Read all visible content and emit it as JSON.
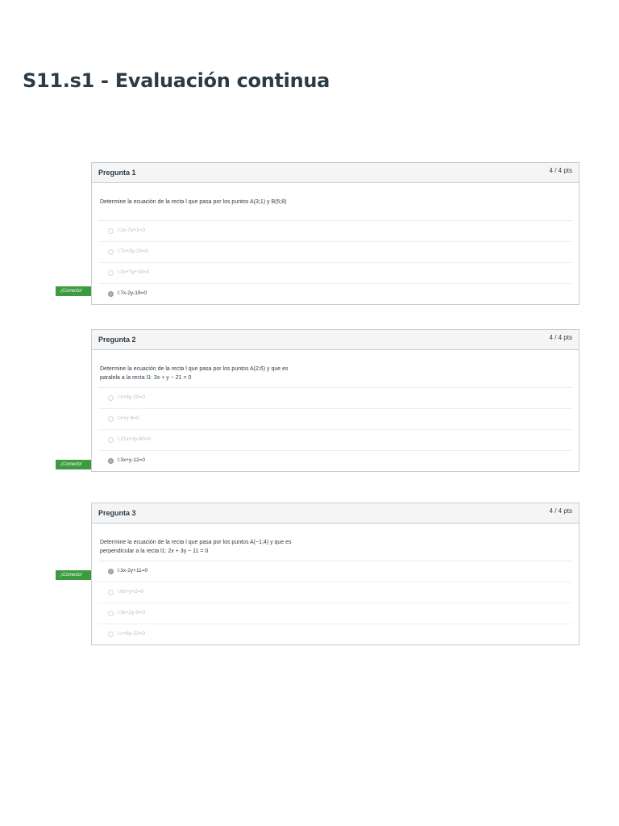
{
  "page": {
    "title": "S11.s1 - Evaluación continua"
  },
  "questions": [
    {
      "name": "Pregunta 1",
      "points": "4 / 4 pts",
      "text_lines": [
        "Determine la ecuación de la recta l que pasa por los puntos A(3;1) y B(5;8)"
      ],
      "answers": [
        "l:2x-7y+1=0",
        "l:7x+2y-23=0",
        "l:2x+7y+19=0",
        "l:7x-2y-19=0"
      ],
      "selected_index": 3,
      "flag_label": "¡Correcto!"
    },
    {
      "name": "Pregunta 2",
      "points": "4 / 4 pts",
      "text_lines": [
        "Determine la ecuación de la recta l que pasa por los puntos A(2;6) y que es",
        "paralela a la recta l1: 3x + y − 21 = 0"
      ],
      "answers": [
        "l:x+3y-20=0",
        "l:x+y-8=0",
        "l:21x+3y-60=0",
        "l:3x+y-12=0"
      ],
      "selected_index": 3,
      "flag_label": "¡Correcto!"
    },
    {
      "name": "Pregunta 3",
      "points": "4 / 4 pts",
      "text_lines": [
        "Determine la ecuación de la recta l que pasa por los puntos A(−1;4) y que es",
        "perpendicular a la recta l1: 2x + 3y − 11 = 0"
      ],
      "answers": [
        "l:3x-2y+11=0",
        "l:6x+y+2=0",
        "l:3x+2y-5=0",
        "l:x+6y-23=0"
      ],
      "selected_index": 0,
      "flag_label": "¡Correcto!"
    }
  ]
}
